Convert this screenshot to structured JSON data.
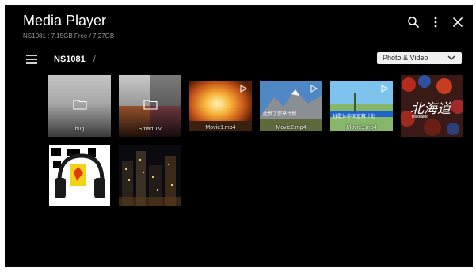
{
  "app": {
    "title": "Media Player",
    "storage": "NS1081 : 7.15GB Free / 7.27GB"
  },
  "toolbar": {
    "search_icon": "search-icon",
    "more_icon": "more-vertical-icon",
    "close_icon": "close-icon"
  },
  "nav": {
    "menu_icon": "hamburger-menu-icon",
    "breadcrumb": "NS1081",
    "separator": "/"
  },
  "filter": {
    "selected": "Photo & Video"
  },
  "items": [
    {
      "label": "bug",
      "type": "folder"
    },
    {
      "label": "Smart TV",
      "type": "folder"
    },
    {
      "label": "Movie1.mp4",
      "type": "video"
    },
    {
      "label": "Movie2.mp4",
      "type": "video"
    },
    {
      "label": "Movie3.mp4",
      "type": "video"
    },
    {
      "label": "",
      "type": "photo"
    },
    {
      "label": "",
      "type": "photo"
    },
    {
      "label": "",
      "type": "photo"
    }
  ],
  "overlay_text": {
    "thumb_movie2": "此步了您来计划",
    "thumb_movie3": "谷歌体中国宣教计划",
    "thumb_photo_logo": "北海道",
    "thumb_photo_logo_sub": "Hokkaido"
  },
  "colors": {
    "background": "#000000",
    "dropdown": "#f0f0f0",
    "text": "#ffffff",
    "muted": "#9a9a9a"
  }
}
